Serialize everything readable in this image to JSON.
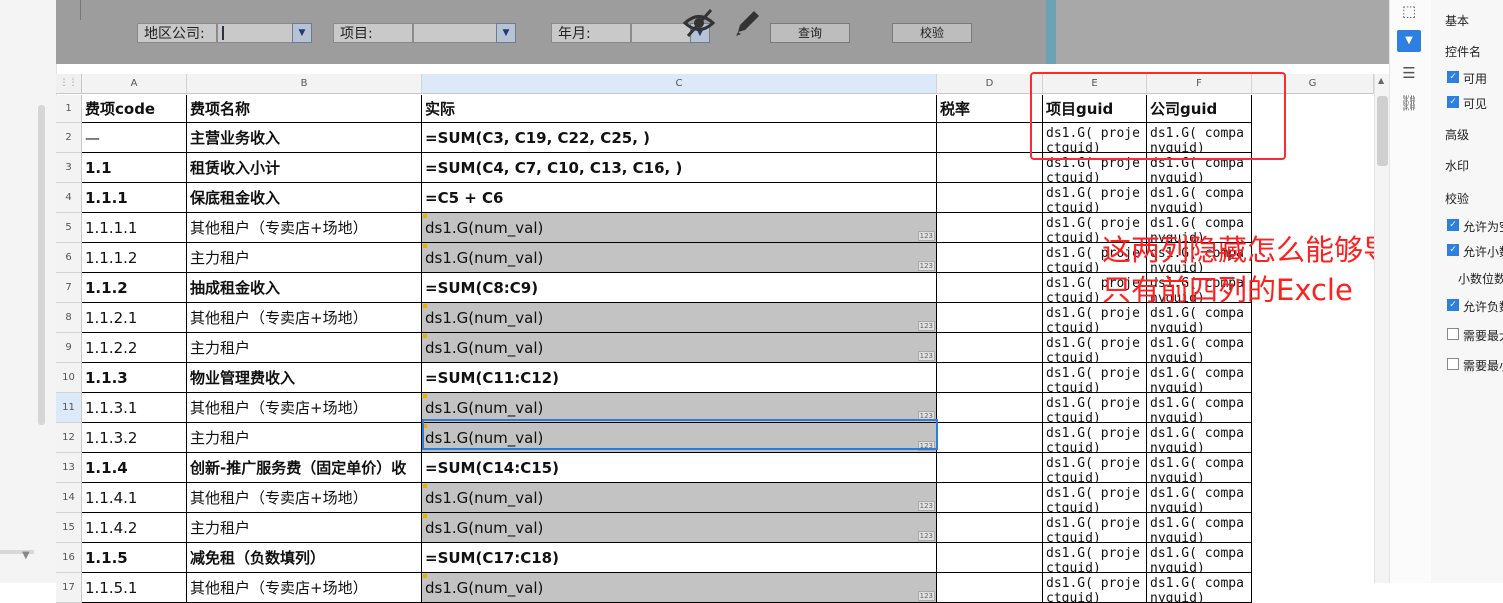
{
  "params": {
    "region_label": "地区公司:",
    "project_label": "项目:",
    "month_label": "年月:",
    "query_button": "查询",
    "validate_button": "校验"
  },
  "columns": [
    "A",
    "B",
    "C",
    "D",
    "E",
    "F",
    "G"
  ],
  "rows": [
    {
      "num": "1",
      "a": "费项code",
      "b": "费项名称",
      "c": "实际",
      "d": "税率",
      "e": "项目guid",
      "f": "公司guid",
      "style": "header"
    },
    {
      "num": "2",
      "a": "—",
      "b": "主营业务收入",
      "c": "=SUM(C3, C19, C22, C25, )",
      "d": "",
      "e": "ds1.G( projectguid)",
      "f": "ds1.G( companyguid)",
      "style": "formula"
    },
    {
      "num": "3",
      "a": "1.1",
      "b": "租赁收入小计",
      "c": "=SUM(C4, C7, C10, C13, C16, )",
      "d": "",
      "e": "ds1.G( projectguid)",
      "f": "ds1.G( companyguid)",
      "style": "formula"
    },
    {
      "num": "4",
      "a": "1.1.1",
      "b": "保底租金收入",
      "c": "=C5 + C6",
      "d": "",
      "e": "ds1.G( projectguid)",
      "f": "ds1.G( companyguid)",
      "style": "formula"
    },
    {
      "num": "5",
      "a": "1.1.1.1",
      "b": "其他租户（专卖店+场地）",
      "c": "ds1.G(num_val)",
      "d": "",
      "e": "ds1.G( projectguid)",
      "f": "ds1.G( companyguid)",
      "style": "data"
    },
    {
      "num": "6",
      "a": "1.1.1.2",
      "b": "主力租户",
      "c": "ds1.G(num_val)",
      "d": "",
      "e": "ds1.G( projectguid)",
      "f": "ds1.G( companyguid)",
      "style": "data"
    },
    {
      "num": "7",
      "a": "1.1.2",
      "b": "抽成租金收入",
      "c": "=SUM(C8:C9)",
      "d": "",
      "e": "ds1.G( projectguid)",
      "f": "ds1.G( companyguid)",
      "style": "formula"
    },
    {
      "num": "8",
      "a": "1.1.2.1",
      "b": "其他租户（专卖店+场地）",
      "c": "ds1.G(num_val)",
      "d": "",
      "e": "ds1.G( projectguid)",
      "f": "ds1.G( companyguid)",
      "style": "data"
    },
    {
      "num": "9",
      "a": "1.1.2.2",
      "b": "主力租户",
      "c": "ds1.G(num_val)",
      "d": "",
      "e": "ds1.G( projectguid)",
      "f": "ds1.G( companyguid)",
      "style": "data"
    },
    {
      "num": "10",
      "a": "1.1.3",
      "b": "物业管理费收入",
      "c": "=SUM(C11:C12)",
      "d": "",
      "e": "ds1.G( projectguid)",
      "f": "ds1.G( companyguid)",
      "style": "formula"
    },
    {
      "num": "11",
      "a": "1.1.3.1",
      "b": "其他租户（专卖店+场地）",
      "c": "ds1.G(num_val)",
      "d": "",
      "e": "ds1.G( projectguid)",
      "f": "ds1.G( companyguid)",
      "style": "data"
    },
    {
      "num": "12",
      "a": "1.1.3.2",
      "b": "主力租户",
      "c": "ds1.G(num_val)",
      "d": "",
      "e": "ds1.G( projectguid)",
      "f": "ds1.G( companyguid)",
      "style": "data"
    },
    {
      "num": "13",
      "a": "1.1.4",
      "b": "创新-推广服务费（固定单价）收",
      "c": "=SUM(C14:C15)",
      "d": "",
      "e": "ds1.G( projectguid)",
      "f": "ds1.G( companyguid)",
      "style": "formula"
    },
    {
      "num": "14",
      "a": "1.1.4.1",
      "b": "其他租户（专卖店+场地）",
      "c": "ds1.G(num_val)",
      "d": "",
      "e": "ds1.G( projectguid)",
      "f": "ds1.G( companyguid)",
      "style": "data"
    },
    {
      "num": "15",
      "a": "1.1.4.2",
      "b": "主力租户",
      "c": "ds1.G(num_val)",
      "d": "",
      "e": "ds1.G( projectguid)",
      "f": "ds1.G( companyguid)",
      "style": "data"
    },
    {
      "num": "16",
      "a": "1.1.5",
      "b": "减免租（负数填列）",
      "c": "=SUM(C17:C18)",
      "d": "",
      "e": "ds1.G( projectguid)",
      "f": "ds1.G( companyguid)",
      "style": "formula"
    },
    {
      "num": "17",
      "a": "1.1.5.1",
      "b": "其他租户（专卖店+场地）",
      "c": "ds1.G(num_val)",
      "d": "",
      "e": "ds1.G( projectguid)",
      "f": "ds1.G( companyguid)",
      "style": "data"
    }
  ],
  "cell_type_tag": "123",
  "annotation": {
    "line1": "这两列隐藏怎么能够导入",
    "line2": "只有前四列的Excle"
  },
  "props_panel": {
    "basic": "基本",
    "widget_name": "控件名",
    "enabled": "可用",
    "visible": "可见",
    "advanced": "高级",
    "watermark": "水印",
    "validate": "校验",
    "allow_empty": "允许为空",
    "allow_decimal": "允许小数",
    "decimal_places": "小数位数",
    "allow_negative": "允许负数",
    "need_max": "需要最大值",
    "need_min": "需要最小值"
  },
  "colors": {
    "red": "#ff2020",
    "accent": "#2e80e0",
    "gray_cell": "#c3c3c3"
  }
}
